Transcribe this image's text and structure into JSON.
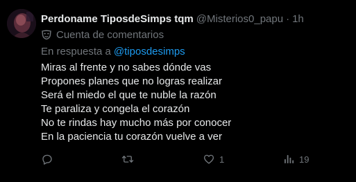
{
  "tweet": {
    "author": {
      "display_name": "Perdoname TiposdeSimps tqm",
      "handle": "@Misterios0_papu",
      "separator": "·",
      "time": "1h"
    },
    "context_label": "Cuenta de comentarios",
    "reply_prefix": "En respuesta a",
    "reply_mention": "@tiposdesimps",
    "lines": [
      "Miras al frente y no sabes dónde vas",
      "Propones planes que no logras realizar",
      "Será el miedo el que te nuble la razón",
      "Te paraliza y congela el corazón",
      "No te rindas hay mucho más por conocer",
      "En la paciencia tu corazón vuelve a ver"
    ],
    "actions": {
      "reply_count": "",
      "retweet_count": "",
      "like_count": "1",
      "views_count": "19"
    }
  },
  "colors": {
    "background": "#000000",
    "primary_text": "#e7e9ea",
    "secondary_text": "#71767b",
    "accent": "#1d9bf0"
  },
  "icons": [
    "avatar",
    "mask-icon",
    "reply-icon",
    "retweet-icon",
    "heart-icon",
    "views-icon"
  ]
}
